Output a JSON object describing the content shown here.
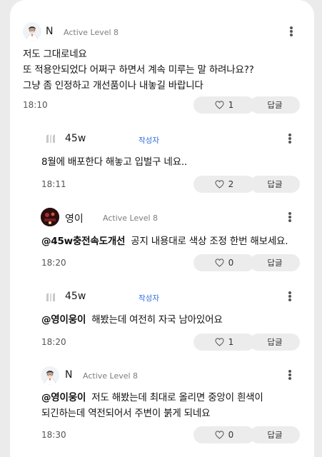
{
  "comments": [
    {
      "user": "N",
      "level": "Active Level 8",
      "avatar": "doctor-avatar",
      "mention": "",
      "lines": [
        "저도 그대로네요",
        "또 적용안되었다 어쩌구 하면서 계속 미루는 말 하려나요??",
        "그냥 좀 인정하고 개선품이나 내놓길 바랍니다"
      ],
      "time": "18:10",
      "likes": "1",
      "reply_label": "답글"
    },
    {
      "user": "45w",
      "badge": "작성자",
      "avatar": "blank-avatar",
      "mention": "",
      "lines": [
        "8월에 배포한다 해놓고 입벌구 네요.."
      ],
      "time": "18:11",
      "likes": "2",
      "reply_label": "답글"
    },
    {
      "user": "영이",
      "level": "Active Level 8",
      "avatar": "photo-avatar",
      "mention": "@45w충전속도개선",
      "lines": [
        "공지 내용대로 색상 조정 한번 해보세요."
      ],
      "time": "18:20",
      "likes": "0",
      "reply_label": "답글"
    },
    {
      "user": "45w",
      "badge": "작성자",
      "avatar": "blank-avatar",
      "mention": "@영이웅이",
      "lines": [
        "해봤는데 여전히 자국 남아있어요"
      ],
      "time": "18:20",
      "likes": "1",
      "reply_label": "답글"
    },
    {
      "user": "N",
      "level": "Active Level 8",
      "avatar": "doctor-avatar",
      "mention": "@영이웅이",
      "lines": [
        "저도 해봤는데 최대로 올리면 중앙이 흰색이",
        "되긴하는데 역전되어서 주변이 붉게 되네요"
      ],
      "time": "18:30",
      "likes": "0",
      "reply_label": "답글"
    }
  ],
  "colors": {
    "badge": "#2f6fde",
    "button_bg": "#ececec",
    "card_bg": "#ffffff",
    "page_bg": "#ebebeb"
  }
}
